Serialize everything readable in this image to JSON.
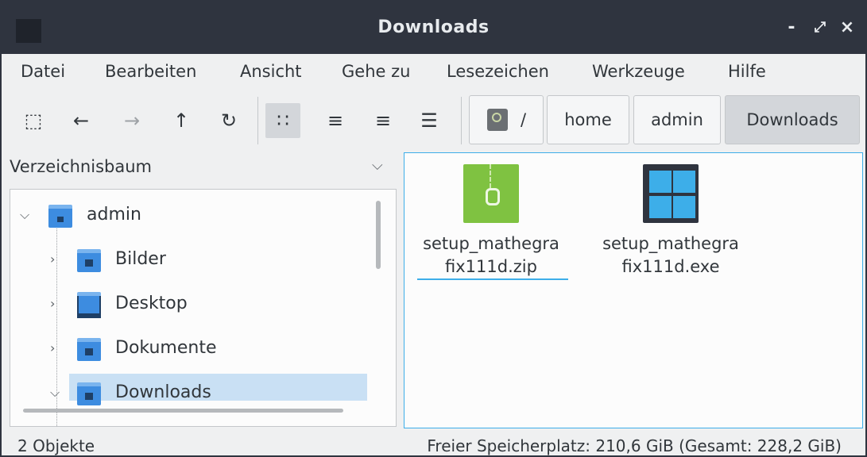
{
  "window": {
    "title": "Downloads"
  },
  "window_controls": [
    "-",
    "⤢",
    "×"
  ],
  "menubar": [
    "Datei",
    "Bearbeiten",
    "Ansicht",
    "Gehe zu",
    "Lesezeichen",
    "Werkzeuge",
    "Hilfe"
  ],
  "toolbar": {
    "icons": {
      "new_window": "⬚",
      "back": "←",
      "forward": "→",
      "up": "↑",
      "reload": "↻",
      "icon_view": "∷",
      "detail_view": "≡",
      "compact_view": "≡",
      "list_view": "☰"
    },
    "breadcrumbs": [
      "/",
      "home",
      "admin",
      "Downloads"
    ]
  },
  "side_pane": {
    "header": "Verzeichnisbaum",
    "tree": [
      "admin",
      "Bilder",
      "Desktop",
      "Dokumente",
      "Downloads"
    ]
  },
  "files": [
    {
      "name": "setup_mathegrafix111d.zip",
      "line1": "setup_mathegra",
      "line2": "fix111d.zip",
      "type": "zip"
    },
    {
      "name": "setup_mathegrafix111d.exe",
      "line1": "setup_mathegra",
      "line2": "fix111d.exe",
      "type": "exe"
    }
  ],
  "status": {
    "count": "2 Objekte",
    "free_space": "Freier Speicherplatz: 210,6 GiB (Gesamt: 228,2 GiB)"
  },
  "colors": {
    "titlebar": "#2f343f",
    "accent": "#3daee9",
    "folder": "#3d8ce0",
    "zip": "#7fc241"
  }
}
